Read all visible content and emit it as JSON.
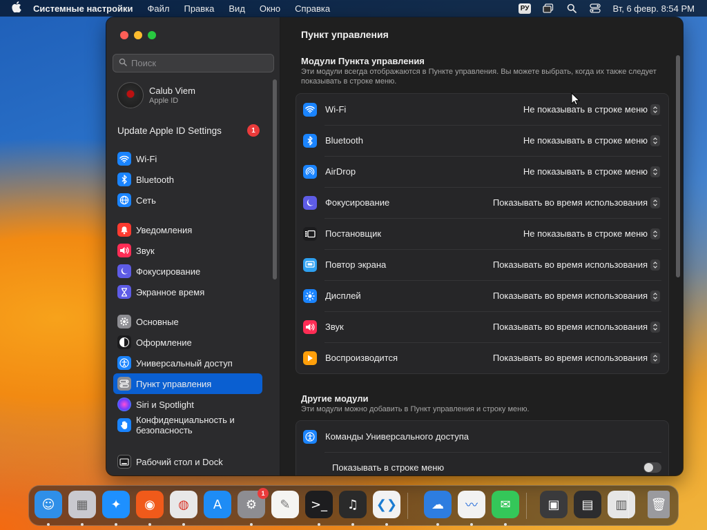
{
  "menubar": {
    "app_name": "Системные настройки",
    "menus": [
      "Файл",
      "Правка",
      "Вид",
      "Окно",
      "Справка"
    ],
    "input_source": "РУ",
    "datetime": "Вт, 6 февр.  8:54 PM"
  },
  "sidebar": {
    "search_placeholder": "Поиск",
    "account": {
      "name": "Calub Viem",
      "subtitle": "Apple ID"
    },
    "update": {
      "label": "Update Apple ID Settings",
      "badge": "1"
    },
    "items": [
      {
        "label": "Wi-Fi",
        "icon": "wifi-icon",
        "color": "#1a84ff"
      },
      {
        "label": "Bluetooth",
        "icon": "bluetooth-icon",
        "color": "#1a84ff"
      },
      {
        "label": "Сеть",
        "icon": "globe-icon",
        "color": "#1a84ff"
      },
      {
        "label": "Уведомления",
        "icon": "bell-icon",
        "color": "#ff3b30"
      },
      {
        "label": "Звук",
        "icon": "speaker-icon",
        "color": "#ff2d55"
      },
      {
        "label": "Фокусирование",
        "icon": "moon-icon",
        "color": "#5e5ce6"
      },
      {
        "label": "Экранное время",
        "icon": "hourglass-icon",
        "color": "#5e5ce6"
      },
      {
        "label": "Основные",
        "icon": "gear-icon",
        "color": "#8e8e93"
      },
      {
        "label": "Оформление",
        "icon": "appearance-icon",
        "color": "#1c1c1e"
      },
      {
        "label": "Универсальный доступ",
        "icon": "accessibility-icon",
        "color": "#1a84ff"
      },
      {
        "label": "Пункт управления",
        "icon": "control-center-icon",
        "color": "#8e8e93"
      },
      {
        "label": "Siri и Spotlight",
        "icon": "siri-icon",
        "color": "#c840e9"
      },
      {
        "label": "Конфиденциальность и безопасность",
        "icon": "hand-icon",
        "color": "#1a84ff"
      },
      {
        "label": "Рабочий стол и Dock",
        "icon": "desktop-dock-icon",
        "color": "#1c1c1e"
      }
    ],
    "selected": "Пункт управления"
  },
  "main": {
    "title": "Пункт управления",
    "modules_section": {
      "title": "Модули Пункта управления",
      "description": "Эти модули всегда отображаются в Пункте управления. Вы можете выбрать, когда их также следует показывать в строке меню."
    },
    "modules": [
      {
        "label": "Wi-Fi",
        "icon": "wifi-icon",
        "color": "#1a84ff",
        "value": "Не показывать в строке меню"
      },
      {
        "label": "Bluetooth",
        "icon": "bluetooth-icon",
        "color": "#1a84ff",
        "value": "Не показывать в строке меню"
      },
      {
        "label": "AirDrop",
        "icon": "airdrop-icon",
        "color": "#1a84ff",
        "value": "Не показывать в строке меню"
      },
      {
        "label": "Фокусирование",
        "icon": "moon-icon",
        "color": "#5e5ce6",
        "value": "Показывать во время использования"
      },
      {
        "label": "Постановщик",
        "icon": "stage-manager-icon",
        "color": "#1c1c1e",
        "value": "Не показывать в строке меню"
      },
      {
        "label": "Повтор экрана",
        "icon": "screen-mirroring-icon",
        "color": "#2ea0f0",
        "value": "Показывать во время использования"
      },
      {
        "label": "Дисплей",
        "icon": "sun-icon",
        "color": "#1a84ff",
        "value": "Показывать во время использования"
      },
      {
        "label": "Звук",
        "icon": "speaker-icon",
        "color": "#ff2d55",
        "value": "Показывать во время использования"
      },
      {
        "label": "Воспроизводится",
        "icon": "play-icon",
        "color": "#ff9f0a",
        "value": "Показывать во время использования"
      }
    ],
    "other_section": {
      "title": "Другие модули",
      "description": "Эти модули можно добавить в Пункт управления и строку меню."
    },
    "other_modules": [
      {
        "label": "Команды Универсального доступа",
        "icon": "accessibility-icon",
        "color": "#1a84ff"
      }
    ],
    "show_in_menubar_label": "Показывать в строке меню",
    "show_in_menubar_on": false
  },
  "dock": {
    "apps": [
      {
        "name": "finder-icon",
        "color": "#2f8fe8"
      },
      {
        "name": "launchpad-icon",
        "color": "#c9c9cf"
      },
      {
        "name": "safari-icon",
        "color": "#1e90ff"
      },
      {
        "name": "firefox-icon",
        "color": "#f05a1a"
      },
      {
        "name": "chrome-icon",
        "color": "#e8e8e8"
      },
      {
        "name": "app-store-icon",
        "color": "#1e8cf5"
      },
      {
        "name": "system-settings-icon",
        "color": "#8d8d92"
      },
      {
        "name": "textedit-icon",
        "color": "#f5f5f2"
      },
      {
        "name": "terminal-icon",
        "color": "#1d1d1f"
      },
      {
        "name": "garageband-icon",
        "color": "#2a2a2a"
      },
      {
        "name": "vscode-icon",
        "color": "#f2f2f2"
      },
      {
        "name": "weather-icon",
        "color": "#2d7de0"
      },
      {
        "name": "freeform-icon",
        "color": "#f2f2f2"
      },
      {
        "name": "messages-icon",
        "color": "#34c759"
      },
      {
        "name": "window-thumbnail-1-icon",
        "color": "#3a3a3c"
      },
      {
        "name": "window-thumbnail-2-icon",
        "color": "#2c2c2e"
      },
      {
        "name": "window-thumbnail-3-icon",
        "color": "#e6e6e6"
      },
      {
        "name": "trash-icon",
        "color": "#9a9a9e"
      }
    ],
    "settings_badge": "1"
  }
}
